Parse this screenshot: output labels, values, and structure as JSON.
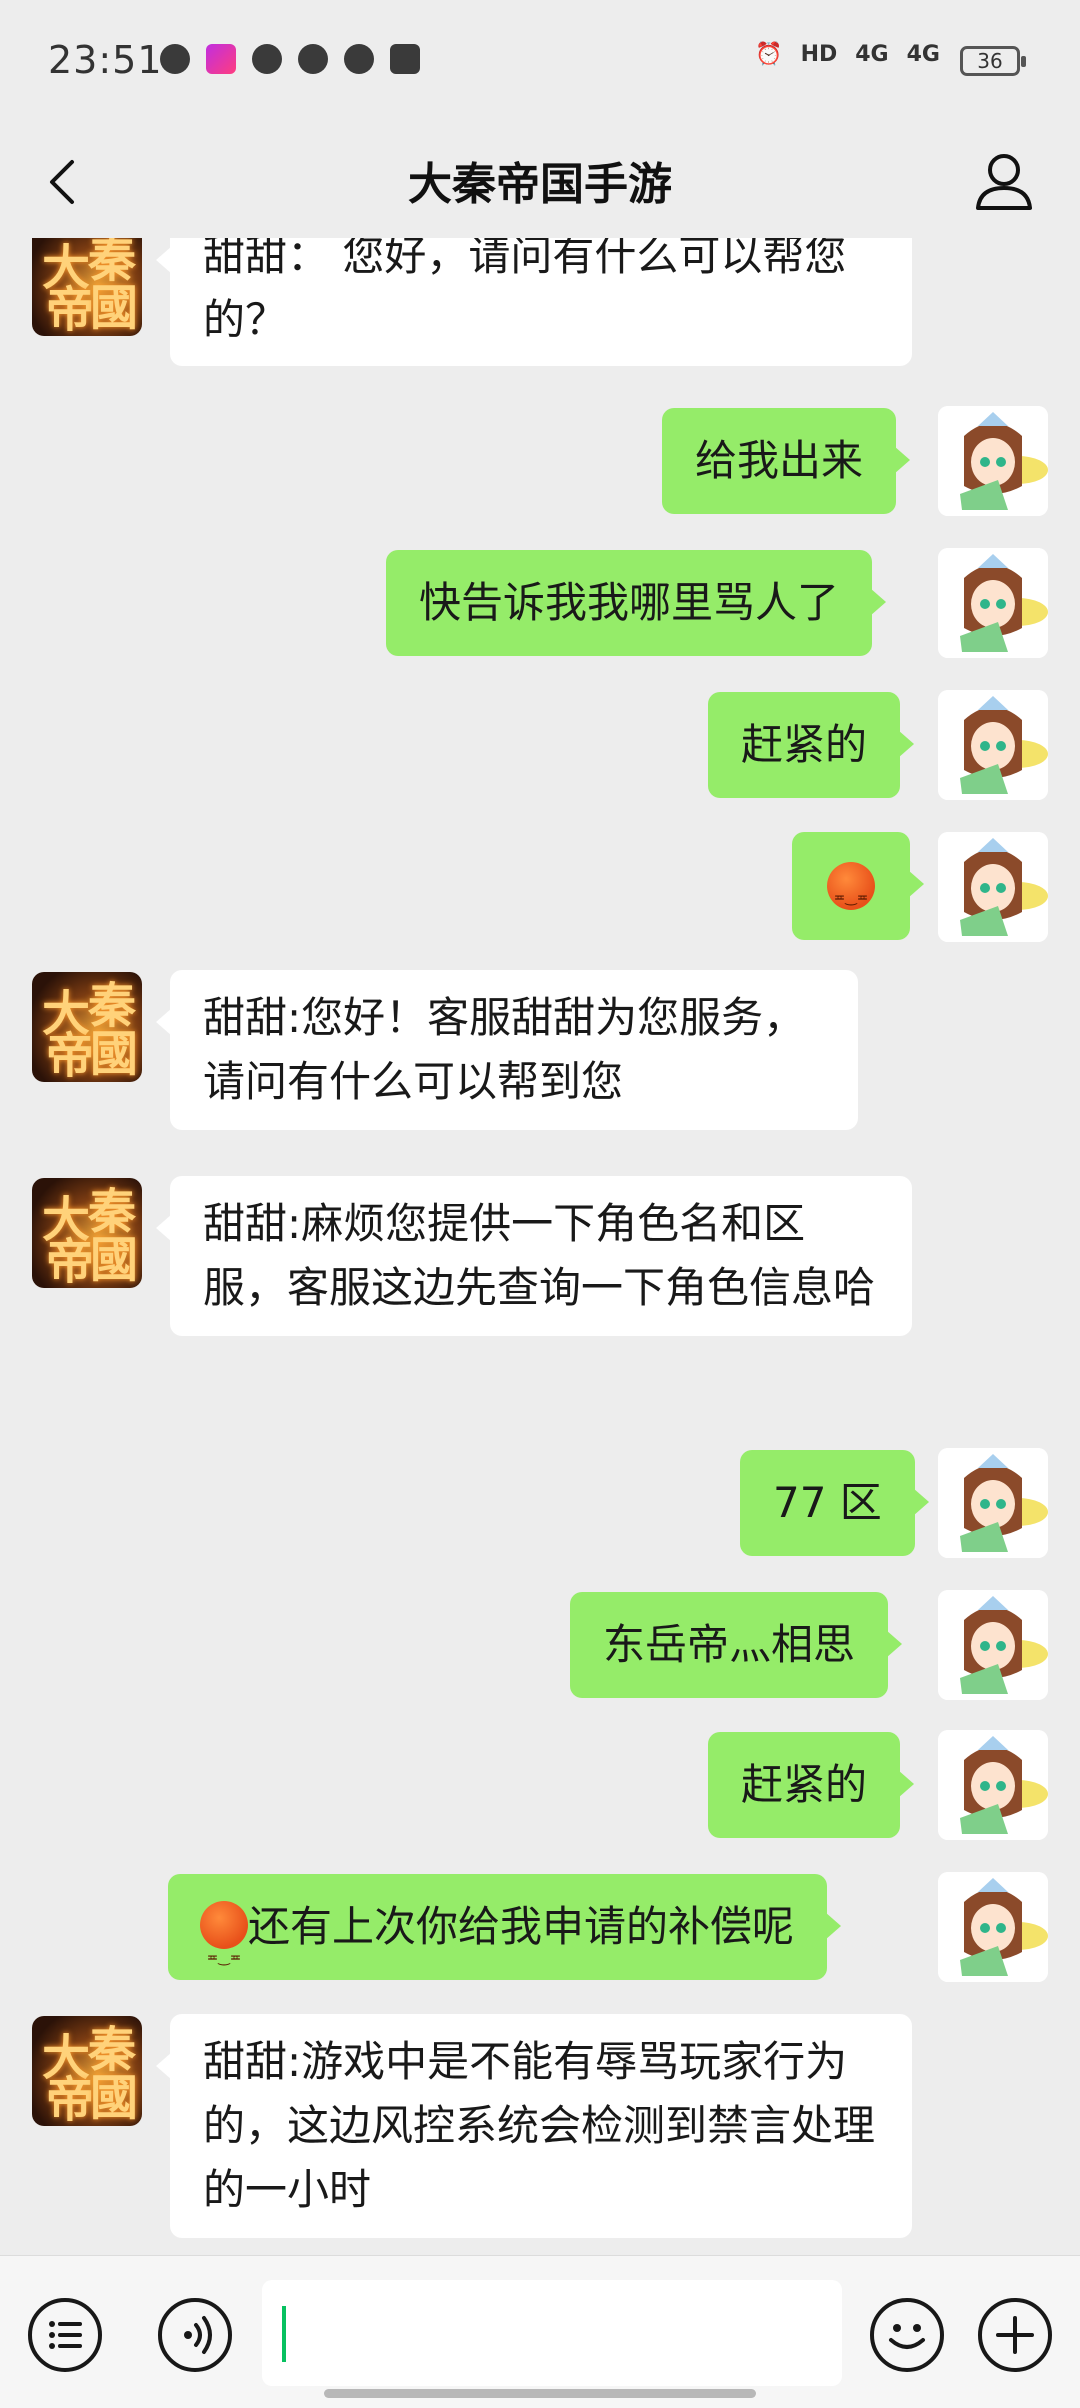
{
  "status_bar": {
    "time": "23:51",
    "network_1": "HD",
    "network_2": "4G",
    "network_3": "4G",
    "battery": "36"
  },
  "header": {
    "title": "大秦帝国手游"
  },
  "messages": [
    {
      "side": "in",
      "text": "甜甜： 您好，请问有什么可以帮您的？"
    },
    {
      "side": "out",
      "text": "给我出来"
    },
    {
      "side": "out",
      "text": "快告诉我我哪里骂人了"
    },
    {
      "side": "out",
      "text": "赶紧的"
    },
    {
      "side": "out",
      "text": "",
      "emoji": "angry-face"
    },
    {
      "side": "in",
      "text": "甜甜:您好！客服甜甜为您服务，请问有什么可以帮到您"
    },
    {
      "side": "in",
      "text": "甜甜:麻烦您提供一下角色名和区服，客服这边先查询一下角色信息哈"
    },
    {
      "side": "out",
      "text": "77 区"
    },
    {
      "side": "out",
      "text": "东岳帝灬相思"
    },
    {
      "side": "out",
      "text": "赶紧的"
    },
    {
      "side": "out",
      "text": "还有上次你给我申请的补偿呢",
      "emoji": "angry-face"
    },
    {
      "side": "in",
      "text": "甜甜:游戏中是不能有辱骂玩家行为的，这边风控系统会检测到禁言处理的一小时"
    }
  ],
  "input": {
    "value": ""
  },
  "colors": {
    "outgoing_bubble": "#95ec69",
    "incoming_bubble": "#ffffff",
    "background": "#ededed",
    "caret": "#07c160"
  }
}
